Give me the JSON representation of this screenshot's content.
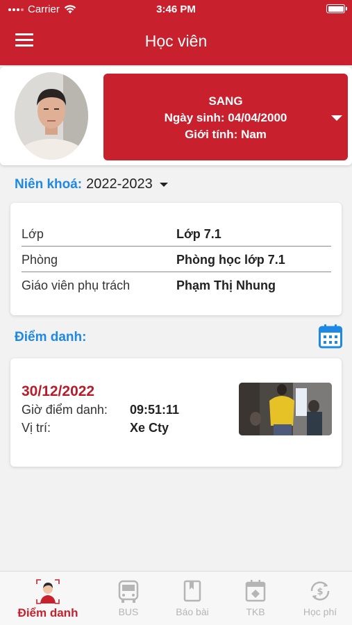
{
  "status_bar": {
    "carrier": "Carrier",
    "time": "3:46 PM"
  },
  "header": {
    "title": "Học viên"
  },
  "student": {
    "name": "SANG",
    "dob_line": "Ngày sinh: 04/04/2000",
    "gender_line": "Giới tính: Nam"
  },
  "year": {
    "label": "Niên khoá:",
    "value": "2022-2023"
  },
  "class_info": [
    {
      "label": "Lớp",
      "value": "Lớp 7.1"
    },
    {
      "label": "Phòng",
      "value": "Phòng học lớp 7.1"
    },
    {
      "label": "Giáo viên phụ trách",
      "value": "Phạm Thị Nhung"
    }
  ],
  "attendance": {
    "section_label": "Điểm danh:",
    "record": {
      "date": "30/12/2022",
      "time_label": "Giờ điểm danh:",
      "time_value": "09:51:11",
      "location_label": "Vị trí:",
      "location_value": "Xe Cty"
    }
  },
  "tabs": [
    {
      "label": "Điểm danh",
      "icon": "student-icon",
      "active": true
    },
    {
      "label": "BUS",
      "icon": "bus-icon"
    },
    {
      "label": "Báo bài",
      "icon": "book-icon"
    },
    {
      "label": "TKB",
      "icon": "timetable-icon"
    },
    {
      "label": "Học phí",
      "icon": "tuition-fee-icon"
    }
  ],
  "colors": {
    "primary": "#c9202e",
    "accent_blue": "#1e88e5",
    "background": "#f2f2f2"
  }
}
